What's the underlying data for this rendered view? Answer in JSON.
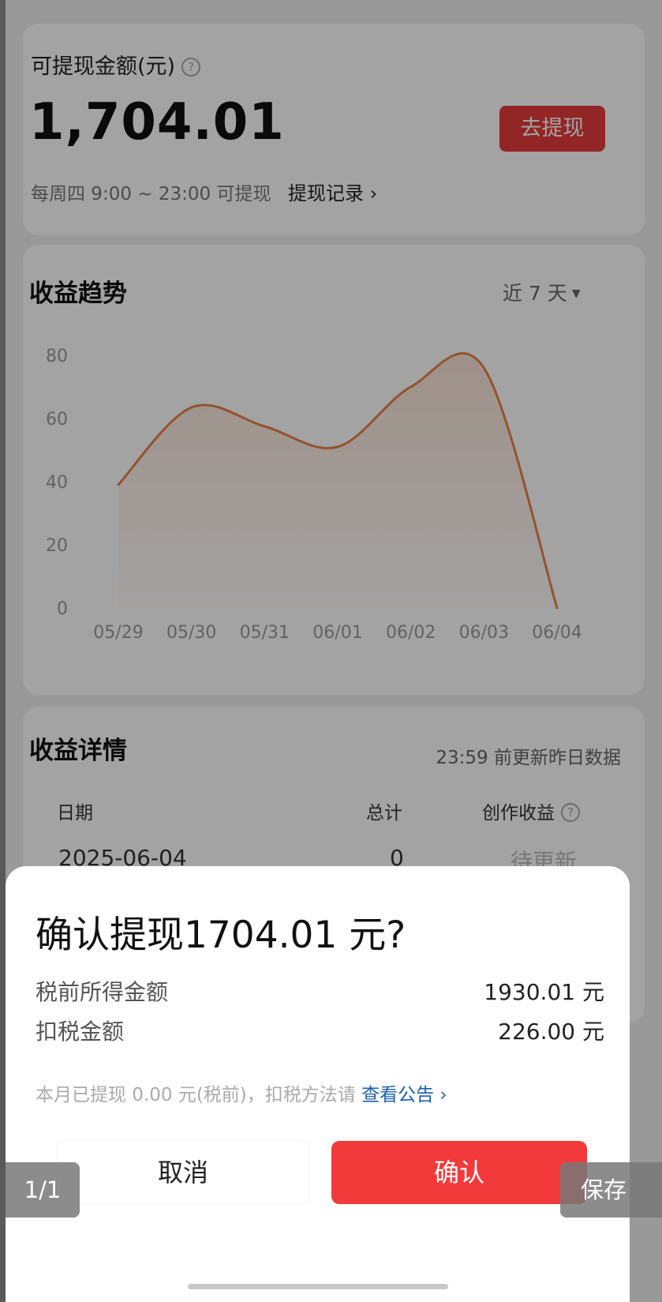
{
  "balance": {
    "label": "可提现金额(元)",
    "help_icon": "?",
    "amount": "1,704.01",
    "withdraw_button": "去提现",
    "schedule_note": "每周四 9:00 ~ 23:00 可提现",
    "record_link": "提现记录 ›"
  },
  "trend": {
    "title": "收益趋势",
    "range_select": "近 7 天",
    "range_caret": "▼"
  },
  "chart_data": {
    "type": "area",
    "x": [
      "05/29",
      "05/30",
      "05/31",
      "06/01",
      "06/02",
      "06/03",
      "06/04"
    ],
    "y_ticks": [
      "0",
      "20",
      "40",
      "60",
      "80"
    ],
    "ylim": [
      0,
      80
    ],
    "grid": false,
    "series": [
      {
        "values": [
          39,
          63.5,
          57.5,
          51,
          70,
          76,
          0
        ],
        "color": "#e8834a"
      }
    ]
  },
  "detail": {
    "title": "收益详情",
    "update_note": "23:59 前更新昨日数据",
    "columns": [
      "日期",
      "总计",
      "创作收益"
    ],
    "rows": [
      {
        "date": "2025-06-04",
        "total": "0",
        "creation": "待更新"
      }
    ]
  },
  "dialog": {
    "title": "确认提现1704.01 元?",
    "rows": [
      {
        "label": "税前所得金额",
        "value": "1930.01 元"
      },
      {
        "label": "扣税金额",
        "value": "226.00 元"
      }
    ],
    "note": "本月已提现 0.00 元(税前)，扣税方法请",
    "notice_link": "查看公告 ›",
    "cancel": "取消",
    "confirm": "确认"
  },
  "viewer": {
    "page_counter": "1/1",
    "save": "保存"
  },
  "colors": {
    "accent_red": "#f23a3a",
    "line_orange": "#e8834a",
    "link_blue": "#1d5fa8"
  }
}
